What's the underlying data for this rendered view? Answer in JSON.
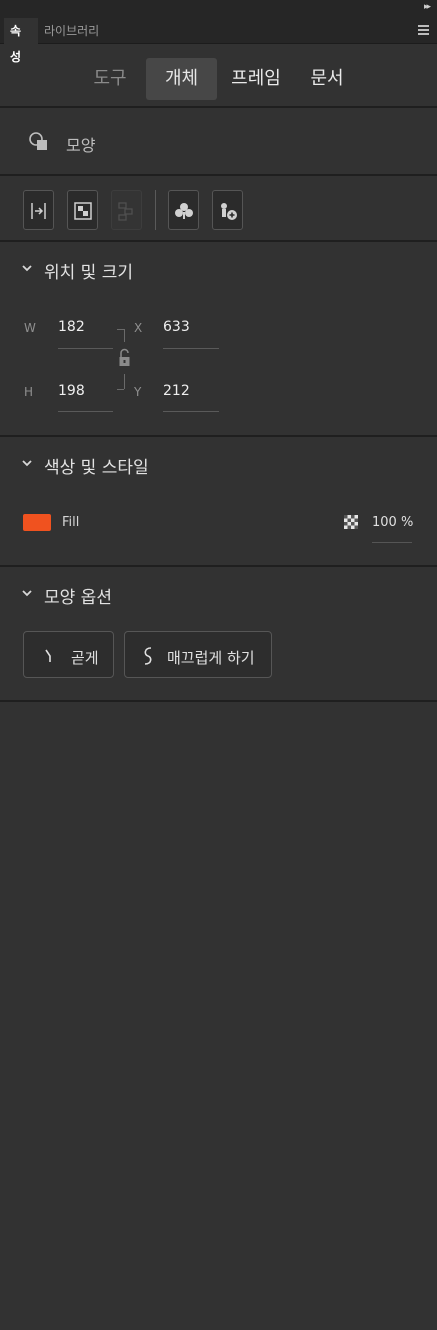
{
  "panel_tabs": [
    {
      "label": "속성",
      "active": true
    },
    {
      "label": "라이브러리",
      "active": false
    }
  ],
  "segments": [
    {
      "label": "도구",
      "state": "dim"
    },
    {
      "label": "개체",
      "state": "selected"
    },
    {
      "label": "프레임",
      "state": "normal"
    },
    {
      "label": "문서",
      "state": "normal"
    }
  ],
  "object": {
    "icon": "shape-icon",
    "type_label": "모양"
  },
  "toolbar": {
    "buttons": [
      {
        "icon": "align-icon",
        "enabled": true
      },
      {
        "icon": "arrange-icon",
        "enabled": true
      },
      {
        "icon": "distribute-icon",
        "enabled": false
      },
      {
        "icon": "break-apart-icon",
        "enabled": true
      },
      {
        "icon": "convert-symbol-icon",
        "enabled": true
      }
    ]
  },
  "position_size": {
    "title": "위치 및 크기",
    "w_label": "W",
    "w": "182",
    "h_label": "H",
    "h": "198",
    "x_label": "X",
    "x": "633",
    "y_label": "Y",
    "y": "212",
    "lock_icon": "unlock-icon"
  },
  "color_style": {
    "title": "색상 및 스타일",
    "fill_label": "Fill",
    "fill_color": "#f0521f",
    "opacity": "100 %"
  },
  "shape_options": {
    "title": "모양 옵션",
    "straighten_label": "곧게",
    "smooth_label": "매끄럽게 하기"
  }
}
